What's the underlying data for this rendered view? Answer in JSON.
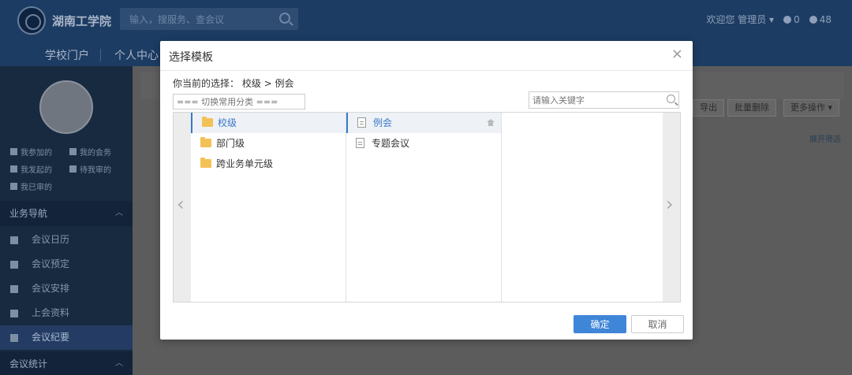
{
  "header": {
    "logo_text": "湖南工学院",
    "search_placeholder": "输入，搜服务、查会议",
    "welcome": "欢迎您",
    "user": "管理员",
    "notice_count": "0",
    "message_count": "48"
  },
  "nav": {
    "items": [
      "学校门户",
      "个人中心"
    ]
  },
  "sidebar": {
    "quick": [
      "我参加的",
      "我的会务",
      "我发起的",
      "待我审的",
      "我已审的"
    ],
    "section1": "业务导航",
    "items": [
      "会议日历",
      "会议预定",
      "会议安排",
      "上会资料",
      "会议纪要"
    ],
    "section2": "会议统计"
  },
  "content": {
    "side_link": "展开筛选",
    "buttons": [
      "导出",
      "批量删除",
      "更多操作"
    ]
  },
  "modal": {
    "title": "选择模板",
    "close": "×",
    "crumb_label": "你当前的选择：",
    "crumb_path": "校级 > 例会",
    "category_placeholder": "=== 切换常用分类 ===",
    "keyword_placeholder": "请输入关键字",
    "col1": [
      "校级",
      "部门级",
      "跨业务单元级"
    ],
    "col2": [
      "例会",
      "专题会议"
    ],
    "prev": "‹",
    "next": "›",
    "ok": "确定",
    "cancel": "取消"
  },
  "colors": {
    "primary": "#3f85d8",
    "header_bg": "#1d3c63",
    "sidebar_bg": "#182a40"
  }
}
